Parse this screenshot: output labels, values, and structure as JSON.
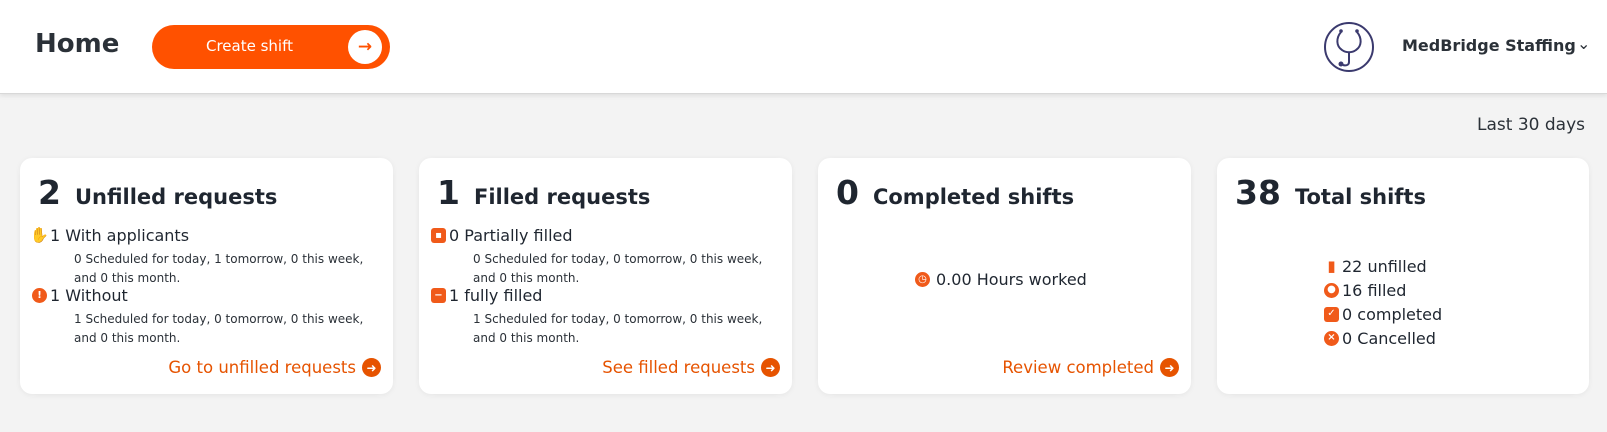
{
  "header": {
    "title": "Home",
    "create_shift_label": "Create shift",
    "create_shift_arrow": "→",
    "org_name": "MedBridge Staffing",
    "org_chevron": "⌄"
  },
  "period_label": "Last 30 days",
  "colors": {
    "accent": "#ff5100",
    "link": "#e65300",
    "text": "#1f2630"
  },
  "cards": {
    "unfilled": {
      "count": "2",
      "title": "Unfilled requests",
      "with_applicants": {
        "label": "1 With applicants",
        "detail": "0 Scheduled for today, 1 tomorrow, 0 this week, and 0 this month.",
        "icon": "hand-icon"
      },
      "without": {
        "label": "1 Without",
        "detail": "1 Scheduled for today, 0 tomorrow, 0 this week, and 0 this month.",
        "icon": "alert-icon"
      },
      "link_label": "Go to unfilled requests"
    },
    "filled": {
      "count": "1",
      "title": "Filled requests",
      "partial": {
        "label": "0 Partially filled",
        "detail": "0 Scheduled for today, 0 tomorrow, 0 this week, and 0 this month.",
        "icon": "calendar-icon"
      },
      "full": {
        "label": "1 fully filled",
        "detail": "1 Scheduled for today, 0 tomorrow, 0 this week, and 0 this month.",
        "icon": "calendar-minus-icon"
      },
      "link_label": "See filled requests"
    },
    "completed": {
      "count": "0",
      "title": "Completed shifts",
      "hours_label": "0.00 Hours worked",
      "link_label": "Review completed"
    },
    "total": {
      "count": "38",
      "title": "Total shifts",
      "items": [
        {
          "label": "22 unfilled",
          "icon": "door-icon"
        },
        {
          "label": "16 filled",
          "icon": "user-icon"
        },
        {
          "label": "0 completed",
          "icon": "check-icon"
        },
        {
          "label": "0 Cancelled",
          "icon": "cancel-icon"
        }
      ]
    }
  },
  "link_arrow": "➜"
}
